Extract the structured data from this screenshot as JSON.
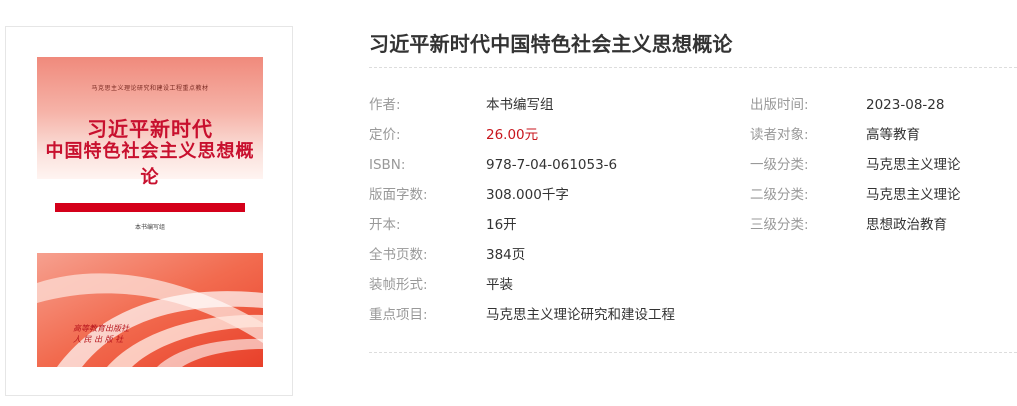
{
  "cover": {
    "series_text": "马克思主义理论研究和建设工程重点教材",
    "title_line1": "习近平新时代",
    "title_line2": "中国特色社会主义思想概论",
    "editor_text": "本书编写组",
    "publisher_line1": "高等教育出版社",
    "publisher_line2": "人 民 出 版 社"
  },
  "book": {
    "title": "习近平新时代中国特色社会主义思想概论"
  },
  "details_left": [
    {
      "label": "作者:",
      "value": "本书编写组"
    },
    {
      "label": "定价:",
      "value": "26.00元"
    },
    {
      "label": "ISBN:",
      "value": "978-7-04-061053-6"
    },
    {
      "label": "版面字数:",
      "value": "308.000千字"
    },
    {
      "label": "开本:",
      "value": "16开"
    },
    {
      "label": "全书页数:",
      "value": "384页"
    },
    {
      "label": "装帧形式:",
      "value": "平装"
    },
    {
      "label": "重点项目:",
      "value": "马克思主义理论研究和建设工程"
    }
  ],
  "details_right": [
    {
      "label": "出版时间:",
      "value": "2023-08-28"
    },
    {
      "label": "读者对象:",
      "value": "高等教育"
    },
    {
      "label": "一级分类:",
      "value": "马克思主义理论"
    },
    {
      "label": "二级分类:",
      "value": "马克思主义理论"
    },
    {
      "label": "三级分类:",
      "value": "思想政治教育"
    }
  ],
  "colors": {
    "price": "#c8161d",
    "label": "#999999",
    "value": "#333333",
    "cover_red": "#d4001a"
  }
}
